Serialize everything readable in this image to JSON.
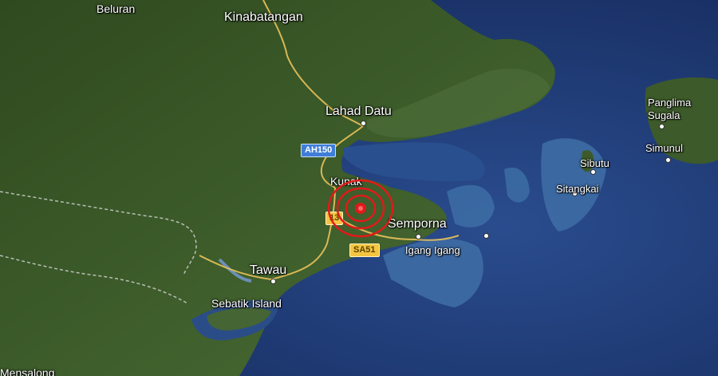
{
  "places": {
    "beluran": "Beluran",
    "kinabatangan": "Kinabatangan",
    "lahad_datu": "Lahad Datu",
    "kunak": "Kunak",
    "semporna": "Semporna",
    "igang_igang": "Igang Igang",
    "tawau": "Tawau",
    "sebatik_island": "Sebatik Island",
    "mensalong": "Mensalong",
    "panglima_sugala": "Panglima\nSugala",
    "simunul": "Simunul",
    "sibutu": "Sibutu",
    "sitangkai": "Sitangkai"
  },
  "roads": {
    "ah150": "AH150",
    "route13": "13",
    "sa51": "SA51"
  },
  "colors": {
    "land": "#3d5a2a",
    "sea": "#1f3b78",
    "shallow": "#3f6fa6",
    "epicenter": "#e01a1a"
  },
  "icons": {
    "epicenter": "earthquake-epicenter-icon"
  }
}
